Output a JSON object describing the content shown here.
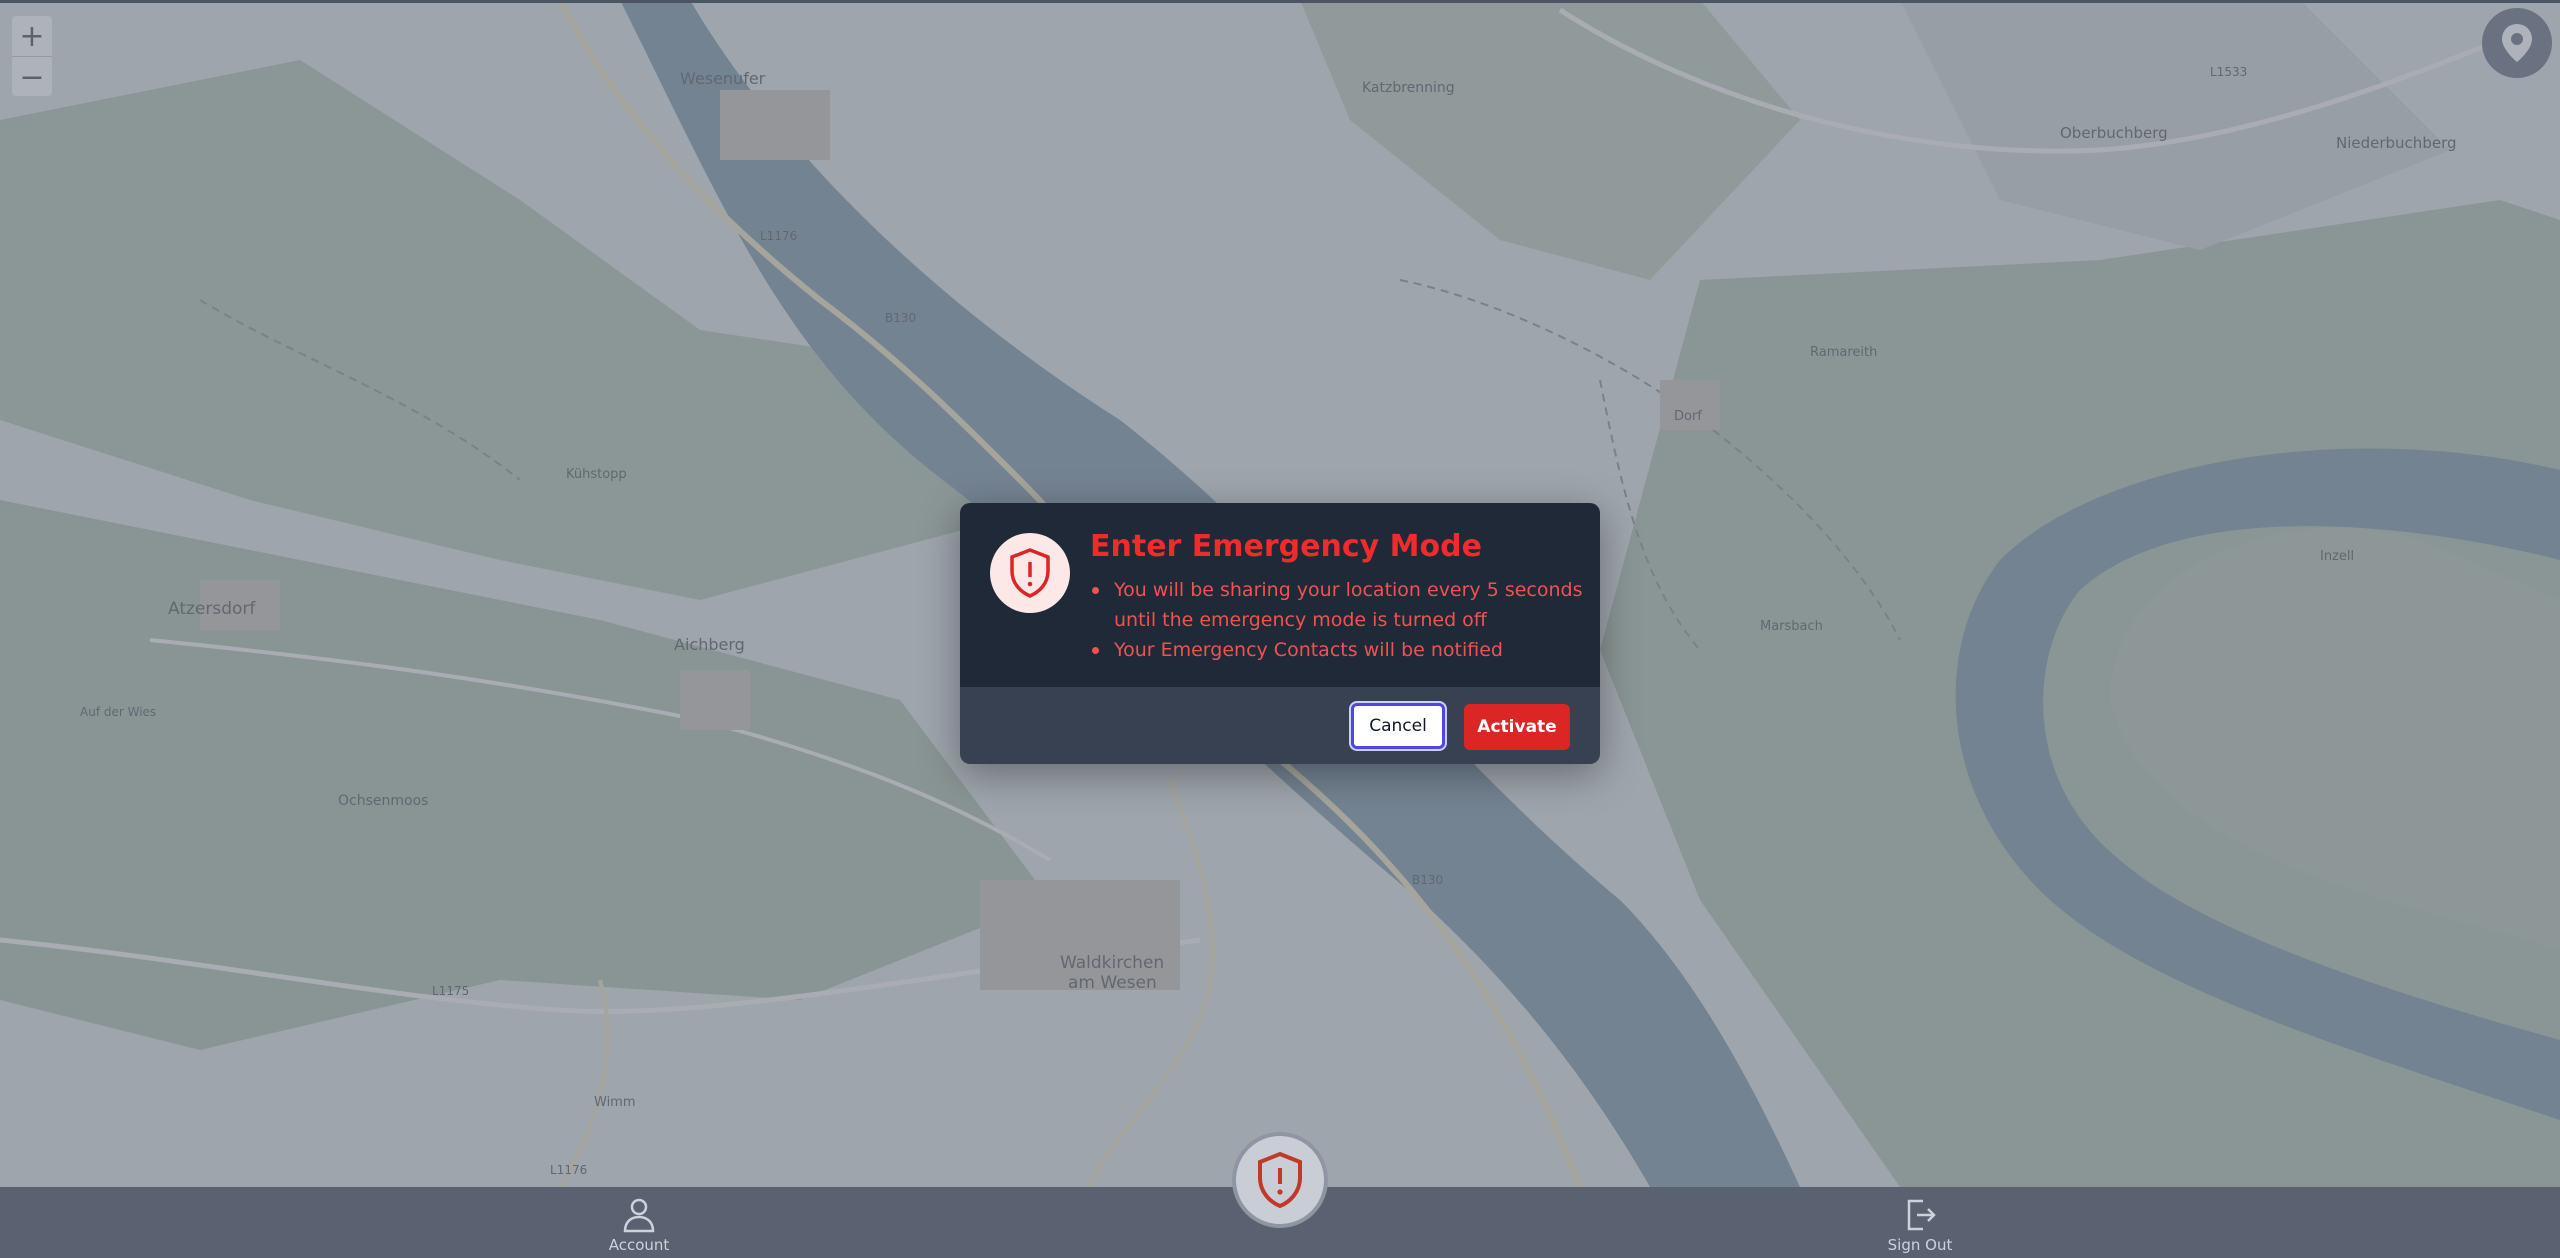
{
  "map": {
    "zoom_in": "+",
    "zoom_out": "−",
    "labels": {
      "wesenufer": "Wesenufer",
      "l1176_a": "L1176",
      "b130_a": "B130",
      "kuhstopp": "Kühstopp",
      "atzersdorf": "Atzersdorf",
      "aichberg": "Aichberg",
      "auf_der_wies": "Auf der Wies",
      "ochsenmoos": "Ochsenmoos",
      "waldkirchen_1": "Waldkirchen",
      "waldkirchen_2": "am Wesen",
      "l1175": "L1175",
      "b130_b": "B130",
      "oberbuchberg": "Oberbuchberg",
      "niederbuchberg": "Niederbuchberg",
      "ramareith": "Ramareith",
      "l1533": "L1533",
      "marsbach": "Marsbach",
      "l1176_b": "L1176",
      "dorf": "Dorf",
      "katzenberg": "Katzbrenning",
      "inzell": "Inzell",
      "wimm": "Wimm"
    }
  },
  "modal": {
    "title": "Enter Emergency Mode",
    "items": [
      "You will be sharing your location every 5 seconds until the emergency mode is turned off",
      "Your Emergency Contacts will be notified"
    ],
    "cancel_label": "Cancel",
    "activate_label": "Activate"
  },
  "nav": {
    "account_label": "Account",
    "signout_label": "Sign Out"
  },
  "colors": {
    "danger": "#dc2626",
    "modal_bg": "#1f2937",
    "footer_bg": "#374151",
    "bottom_bar": "#5a6170"
  }
}
